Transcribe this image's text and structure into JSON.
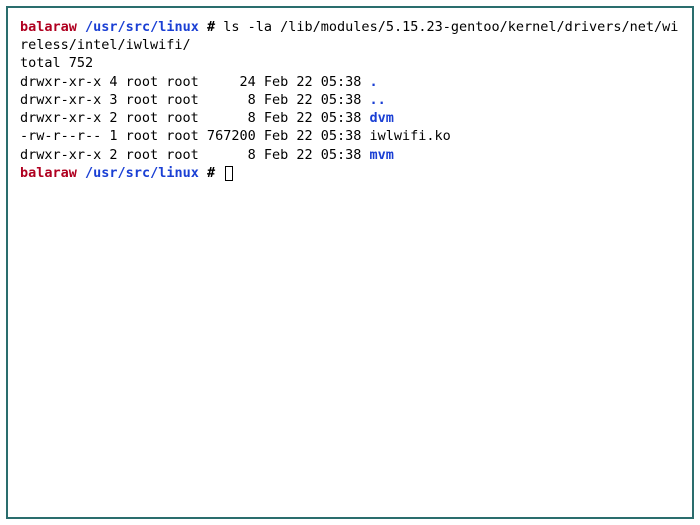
{
  "prompt1": {
    "host": "balaraw",
    "path": "/usr/src/linux",
    "symbol": "#",
    "command": "ls -la /lib/modules/5.15.23-gentoo/kernel/drivers/net/wireless/intel/iwlwifi/"
  },
  "output": {
    "total": "total 752",
    "lines": [
      {
        "perm": "drwxr-xr-x 4 root root     24 Feb 22 05:38 ",
        "name": ".",
        "cls": "dir"
      },
      {
        "perm": "drwxr-xr-x 3 root root      8 Feb 22 05:38 ",
        "name": "..",
        "cls": "dir"
      },
      {
        "perm": "drwxr-xr-x 2 root root      8 Feb 22 05:38 ",
        "name": "dvm",
        "cls": "dir"
      },
      {
        "perm": "-rw-r--r-- 1 root root 767200 Feb 22 05:38 ",
        "name": "iwlwifi.ko",
        "cls": ""
      },
      {
        "perm": "drwxr-xr-x 2 root root      8 Feb 22 05:38 ",
        "name": "mvm",
        "cls": "dir"
      }
    ]
  },
  "prompt2": {
    "host": "balaraw",
    "path": "/usr/src/linux",
    "symbol": "#"
  }
}
